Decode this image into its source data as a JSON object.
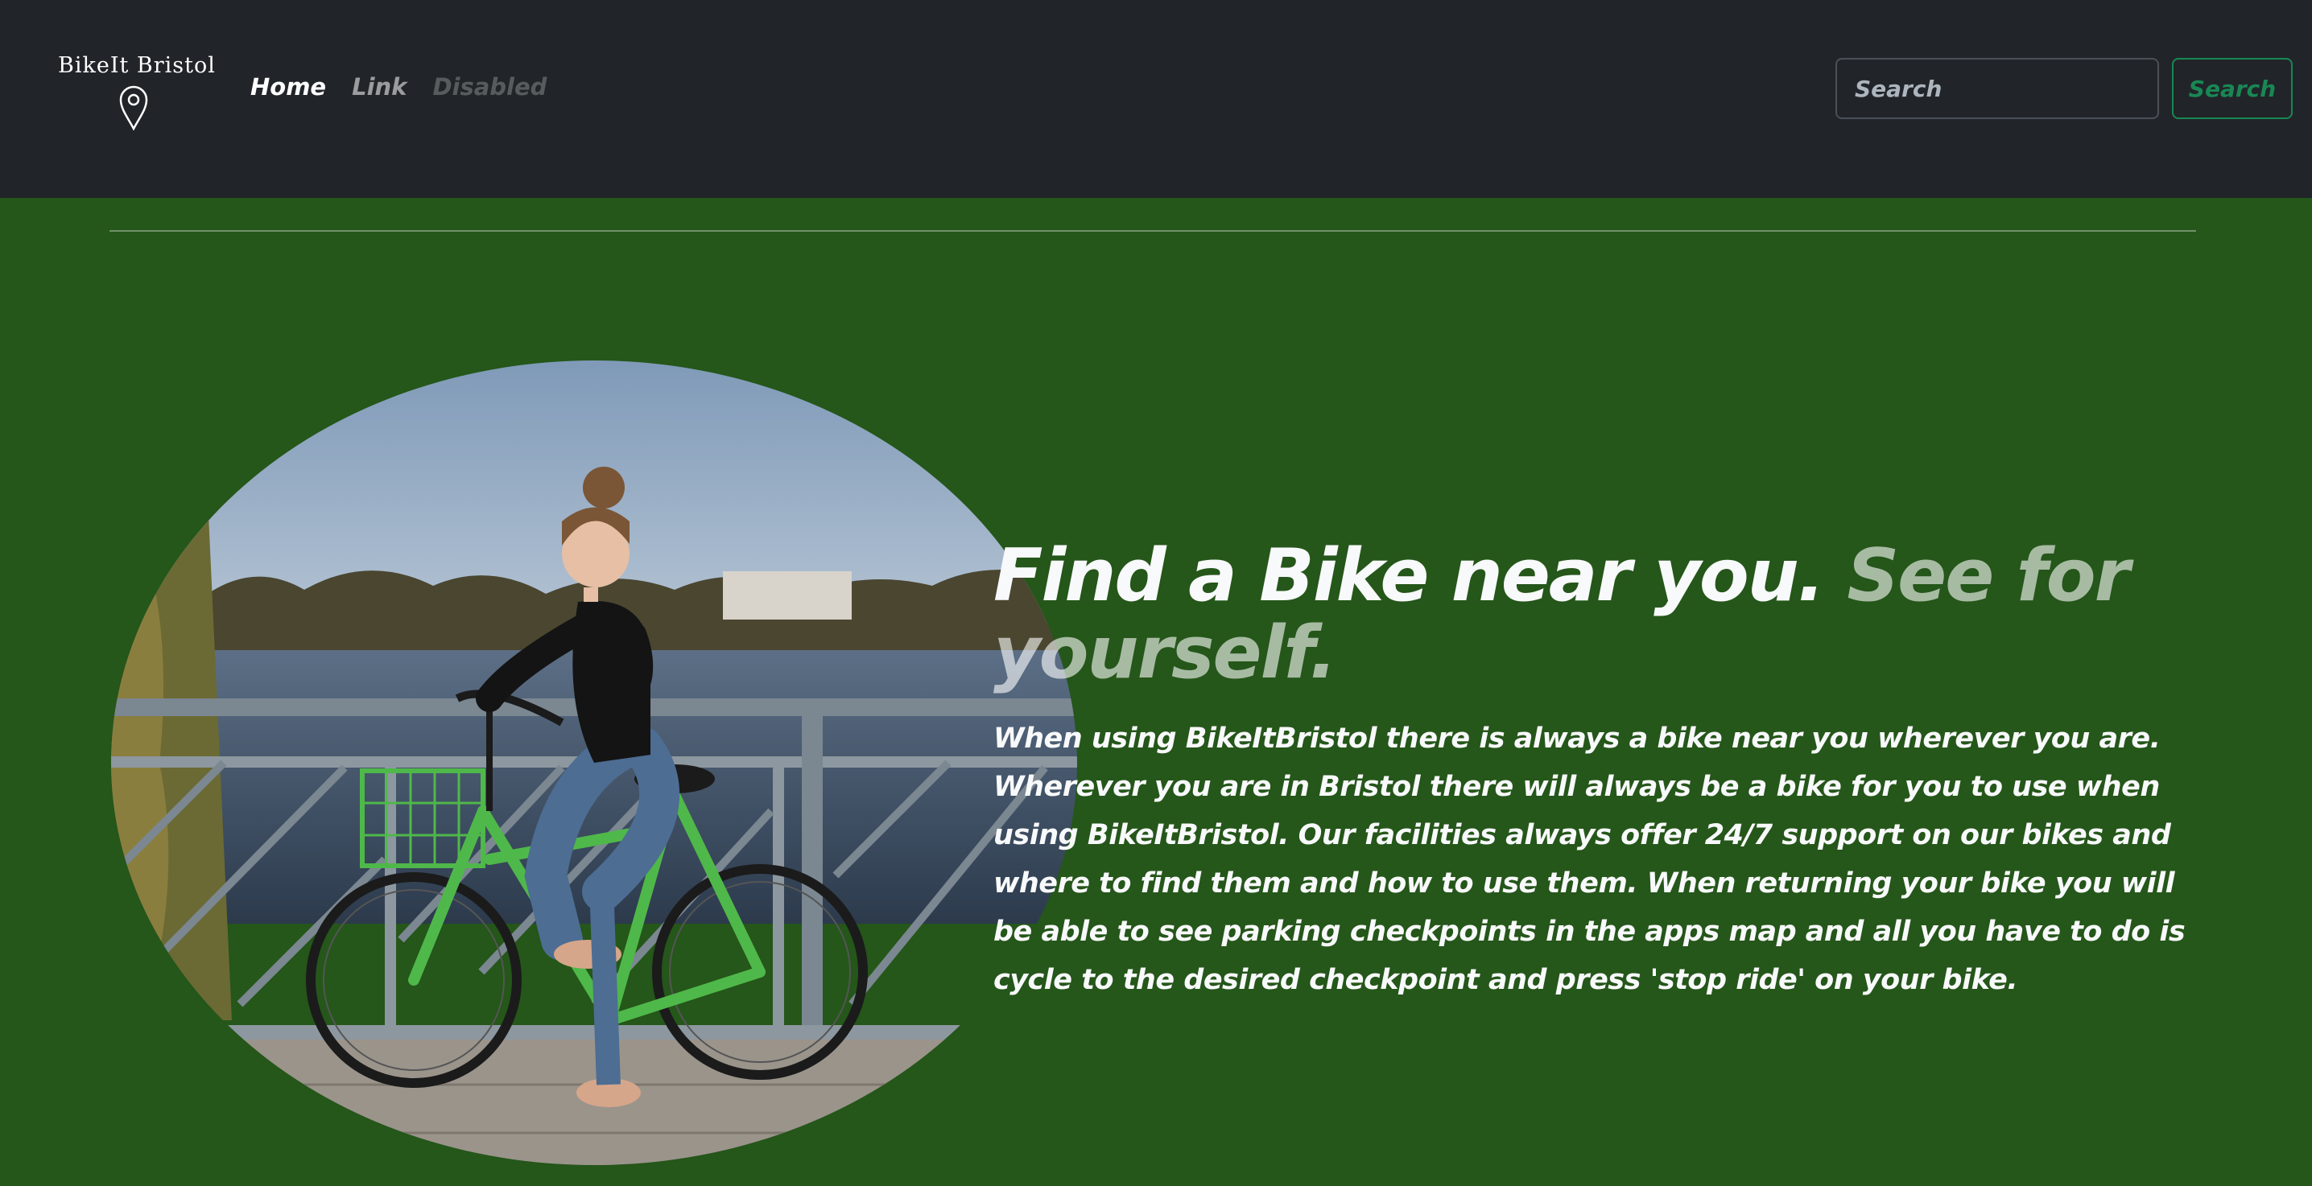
{
  "navbar": {
    "brand": {
      "text": "BikeIt Bristol",
      "icon": "map-pin-icon"
    },
    "links": [
      {
        "label": "Home",
        "state": "active"
      },
      {
        "label": "Link",
        "state": "default"
      },
      {
        "label": "Disabled",
        "state": "disabled"
      }
    ],
    "search": {
      "placeholder": "Search",
      "button_label": "Search"
    }
  },
  "hero": {
    "headline_main": "Find a Bike near you.",
    "headline_muted": "See for yourself.",
    "body": "When using BikeItBristol there is always a bike near you wherever you are. Wherever you are in Bristol there will always be a bike for you to use when using BikeItBristol. Our facilities always offer 24/7 support on our bikes and where to find them and how to use them. When returning your bike you will be able to see parking checkpoints in the apps map and all you have to do is cycle to the desired checkpoint and press 'stop ride' on your bike.",
    "image": "woman-on-green-bicycle-photo"
  },
  "colors": {
    "navbar_bg": "#212529",
    "page_bg": "#25561a",
    "accent_green": "#198754",
    "bike_green": "#4fb84a"
  }
}
